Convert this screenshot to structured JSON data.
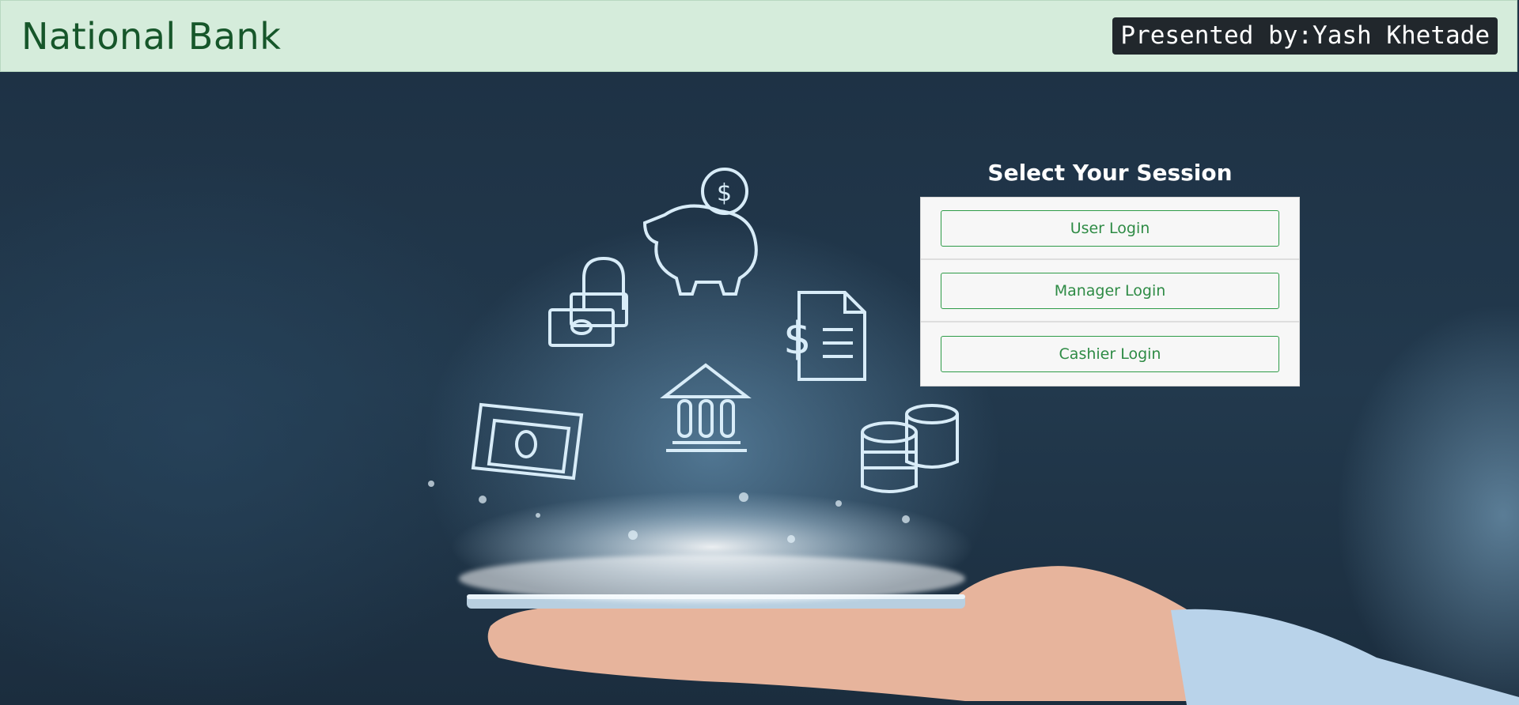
{
  "header": {
    "brand": "National Bank",
    "presenter": "Presented by:Yash Khetade"
  },
  "session": {
    "title": "Select Your Session",
    "buttons": [
      {
        "label": "User Login"
      },
      {
        "label": "Manager Login"
      },
      {
        "label": "Cashier Login"
      }
    ]
  },
  "hero": {
    "icons": [
      "piggy-bank-icon",
      "lock-cash-icon",
      "invoice-icon",
      "bank-building-icon",
      "banknote-icon",
      "coins-icon",
      "hand-phone-icon"
    ]
  },
  "colors": {
    "header_bg": "#d5ecdb",
    "brand_text": "#16562a",
    "button_accent": "#2e9b48"
  }
}
